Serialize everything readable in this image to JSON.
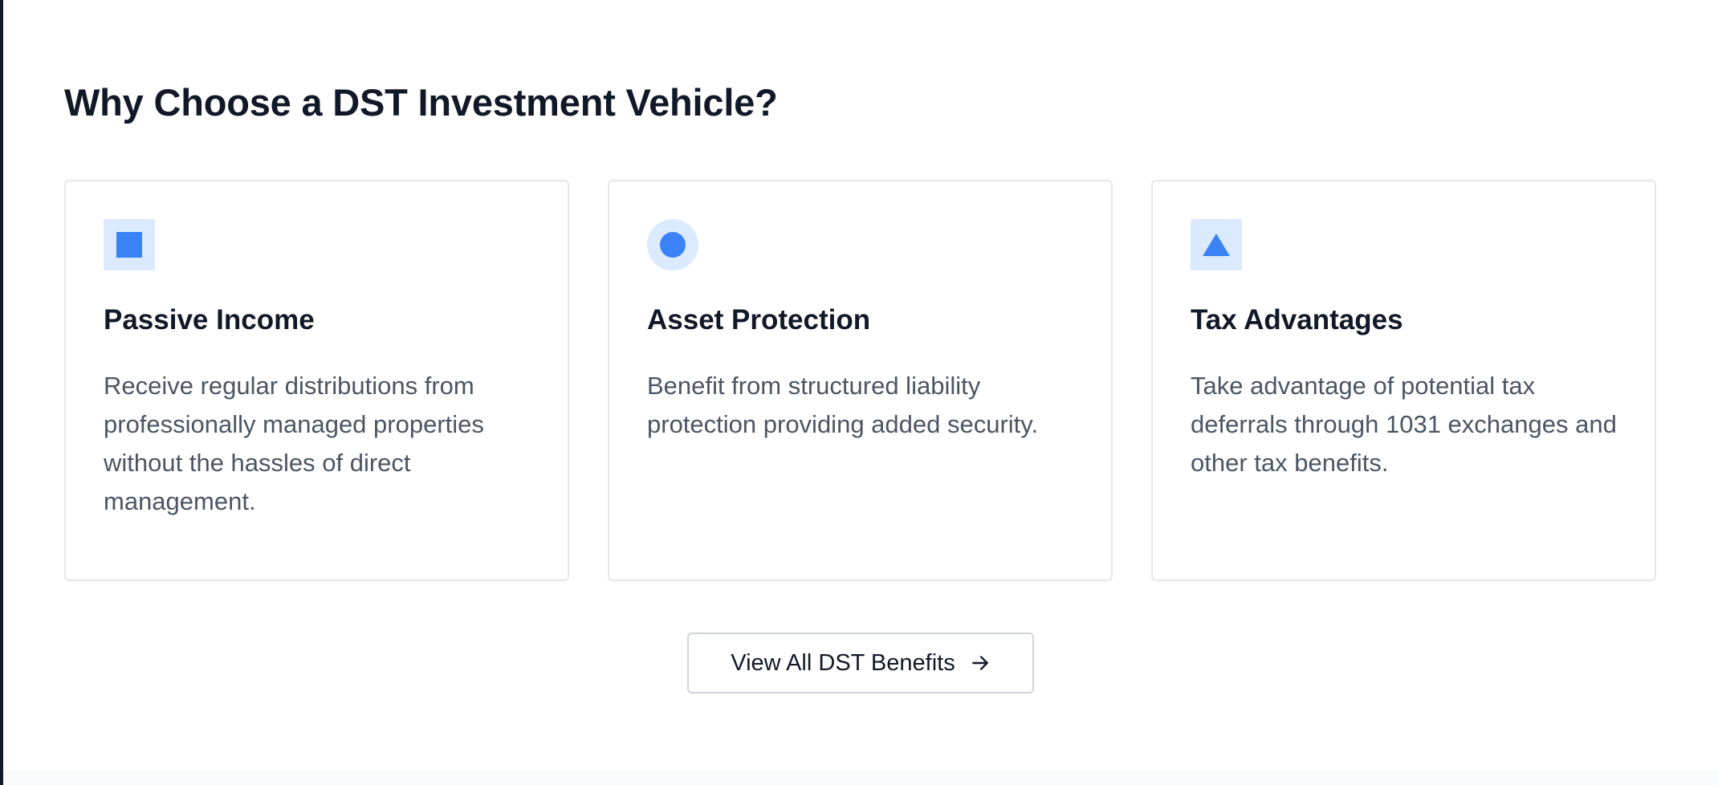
{
  "section": {
    "title": "Why Choose a DST Investment Vehicle?"
  },
  "cards": [
    {
      "icon": "square-icon",
      "title": "Passive Income",
      "description": "Receive regular distributions from professionally managed properties without the hassles of direct management."
    },
    {
      "icon": "circle-icon",
      "title": "Asset Protection",
      "description": "Benefit from structured liability protection providing added security."
    },
    {
      "icon": "triangle-icon",
      "title": "Tax Advantages",
      "description": "Take advantage of potential tax deferrals through 1031 exchanges and other tax benefits."
    }
  ],
  "cta": {
    "label": "View All DST Benefits",
    "icon": "arrow-right-icon"
  },
  "colors": {
    "accent": "#3b82f6",
    "accent_soft": "#dbeafe",
    "heading": "#111827",
    "body_text": "#4b5563",
    "border": "#e5e7eb"
  }
}
